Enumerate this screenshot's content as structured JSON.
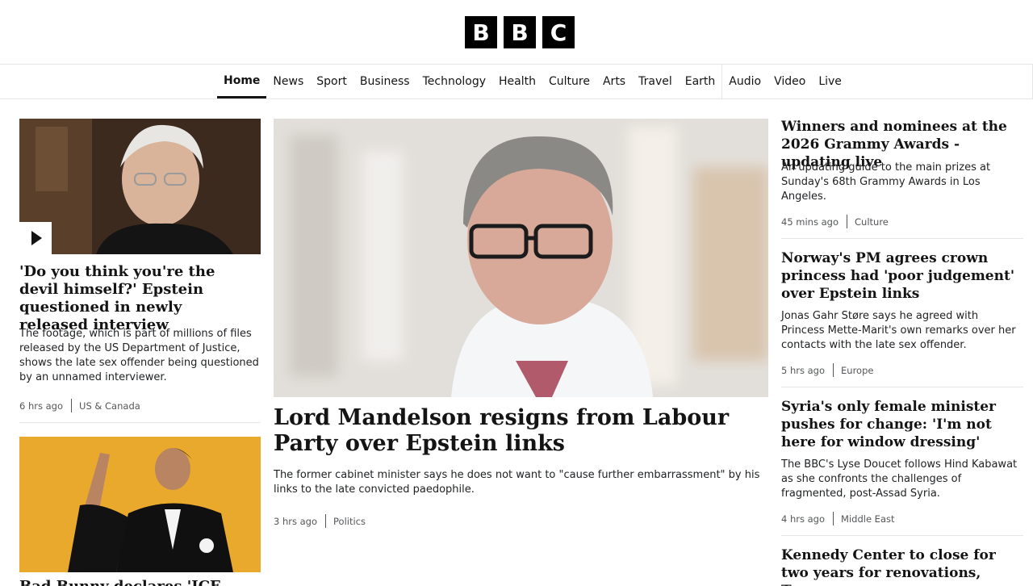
{
  "header": {
    "logo_letters": [
      "B",
      "B",
      "C"
    ]
  },
  "nav": {
    "items": [
      {
        "label": "Home",
        "active": true
      },
      {
        "label": "News"
      },
      {
        "label": "Sport"
      },
      {
        "label": "Business"
      },
      {
        "label": "Technology"
      },
      {
        "label": "Health"
      },
      {
        "label": "Culture"
      },
      {
        "label": "Arts"
      },
      {
        "label": "Travel"
      },
      {
        "label": "Earth"
      },
      {
        "label": "Audio"
      },
      {
        "label": "Video"
      },
      {
        "label": "Live"
      }
    ]
  },
  "left": {
    "story1": {
      "title": "'Do you think you're the devil himself?' Epstein questioned in newly released interview",
      "summary": "The footage, which is part of millions of files released by the US Department of Justice, shows the late sex offender being questioned by an unnamed interviewer.",
      "time": "6 hrs ago",
      "section": "US & Canada"
    },
    "story2": {
      "title": "Bad Bunny declares 'ICE out' as he wins"
    }
  },
  "center": {
    "title": "Lord Mandelson resigns from Labour Party over Epstein links",
    "summary": "The former cabinet minister says he does not want to \"cause further embarrassment\" by his links to the late convicted paedophile.",
    "time": "3 hrs ago",
    "section": "Politics"
  },
  "right": {
    "stories": [
      {
        "title": "Winners and nominees at the 2026 Grammy Awards - updating live",
        "summary": "An updating guide to the main prizes at Sunday's 68th Grammy Awards in Los Angeles.",
        "time": "45 mins ago",
        "section": "Culture"
      },
      {
        "title": "Norway's PM agrees crown princess had 'poor judgement' over Epstein links",
        "summary": "Jonas Gahr Støre says he agreed with Princess Mette-Marit's own remarks over her contacts with the late sex offender.",
        "time": "5 hrs ago",
        "section": "Europe"
      },
      {
        "title": "Syria's only female minister pushes for change: 'I'm not here for window dressing'",
        "summary": "The BBC's Lyse Doucet follows Hind Kabawat as she confronts the challenges of fragmented, post-Assad Syria.",
        "time": "4 hrs ago",
        "section": "Middle East"
      },
      {
        "title": "Kennedy Center to close for two years for renovations, Trump says"
      }
    ]
  },
  "colors": {
    "text": "#141414",
    "muted": "#545658",
    "rule": "#e6e6e6"
  }
}
